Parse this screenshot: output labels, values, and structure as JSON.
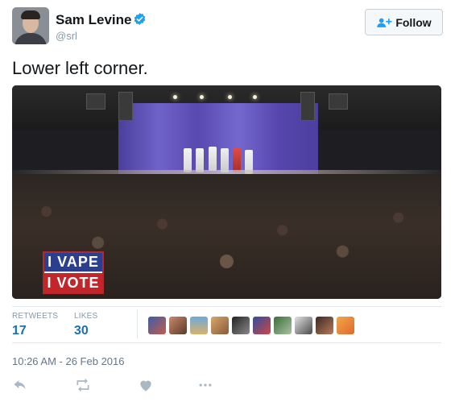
{
  "author": {
    "name": "Sam Levine",
    "handle": "@srl",
    "verified": true,
    "verified_color": "#1da1f2"
  },
  "follow_button": {
    "label": "Follow",
    "icon": "add-user-icon"
  },
  "tweet": {
    "text": "Lower left corner.",
    "media": {
      "sign_line1": "I VAPE",
      "sign_line2": "I VOTE"
    }
  },
  "stats": {
    "retweets_label": "RETWEETS",
    "retweets_count": "17",
    "likes_label": "LIKES",
    "likes_count": "30",
    "liker_avatar_count": 10
  },
  "timestamp": "10:26 AM - 26 Feb 2016",
  "actions": [
    "reply-icon",
    "retweet-icon",
    "like-icon",
    "more-icon"
  ],
  "colors": {
    "link_blue": "#1b6fb5",
    "muted": "#8899a6",
    "divider": "#e1e8ed"
  }
}
